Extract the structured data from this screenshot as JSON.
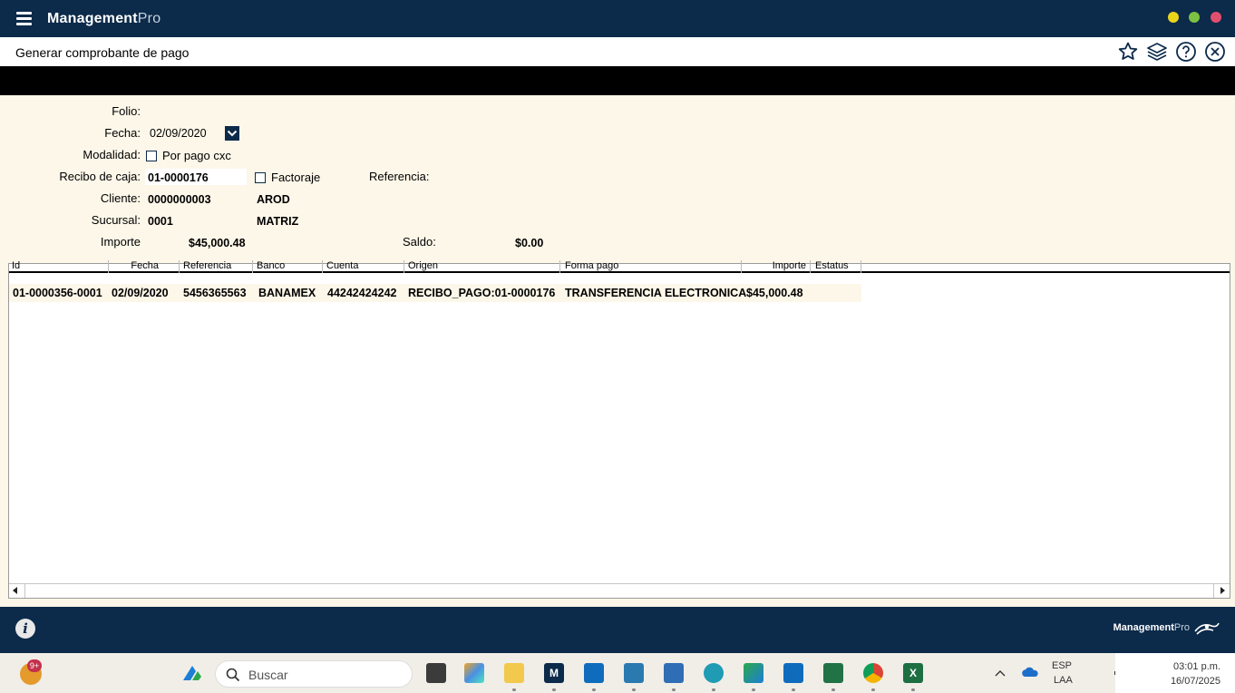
{
  "titlebar": {
    "app_name": "Management",
    "app_name_suffix": "Pro"
  },
  "page": {
    "title": "Generar comprobante de pago"
  },
  "form": {
    "folio_label": "Folio:",
    "fecha_label": "Fecha:",
    "fecha_value": "02/09/2020",
    "modalidad_label": "Modalidad:",
    "por_pago_label": "Por pago cxc",
    "recibo_label": "Recibo de caja:",
    "recibo_value": "01-0000176",
    "factoraje_label": "Factoraje",
    "referencia_label": "Referencia:",
    "cliente_label": "Cliente:",
    "cliente_code": "0000000003",
    "cliente_name": "AROD",
    "sucursal_label": "Sucursal:",
    "sucursal_code": "0001",
    "sucursal_name": "MATRIZ",
    "importe_label": "Importe",
    "importe_value": "$45,000.48",
    "saldo_label": "Saldo:",
    "saldo_value": "$0.00"
  },
  "grid": {
    "columns": [
      "Id",
      "Fecha",
      "Referencia",
      "Banco",
      "Cuenta",
      "Origen",
      "Forma pago",
      "Importe",
      "Estatus"
    ],
    "rows": [
      [
        "01-0000356-0001",
        "02/09/2020",
        "5456365563",
        "BANAMEX",
        "44242424242",
        "RECIBO_PAGO:01-0000176",
        "TRANSFERENCIA ELECTRONICA",
        "$45,000.48",
        ""
      ]
    ]
  },
  "footer": {
    "brand": "Management",
    "brand_suffix": "Pro"
  },
  "taskbar": {
    "search_placeholder": "Buscar",
    "notification_count": "9+",
    "lang_top": "ESP",
    "lang_bottom": "LAA",
    "time": "03:01 p.m.",
    "date": "16/07/2025"
  },
  "colors": {
    "navy": "#0c2a4a",
    "cream": "#fdf7e9",
    "dot_yellow": "#e8d51a",
    "dot_green": "#7cc242",
    "dot_red": "#e0506e"
  }
}
